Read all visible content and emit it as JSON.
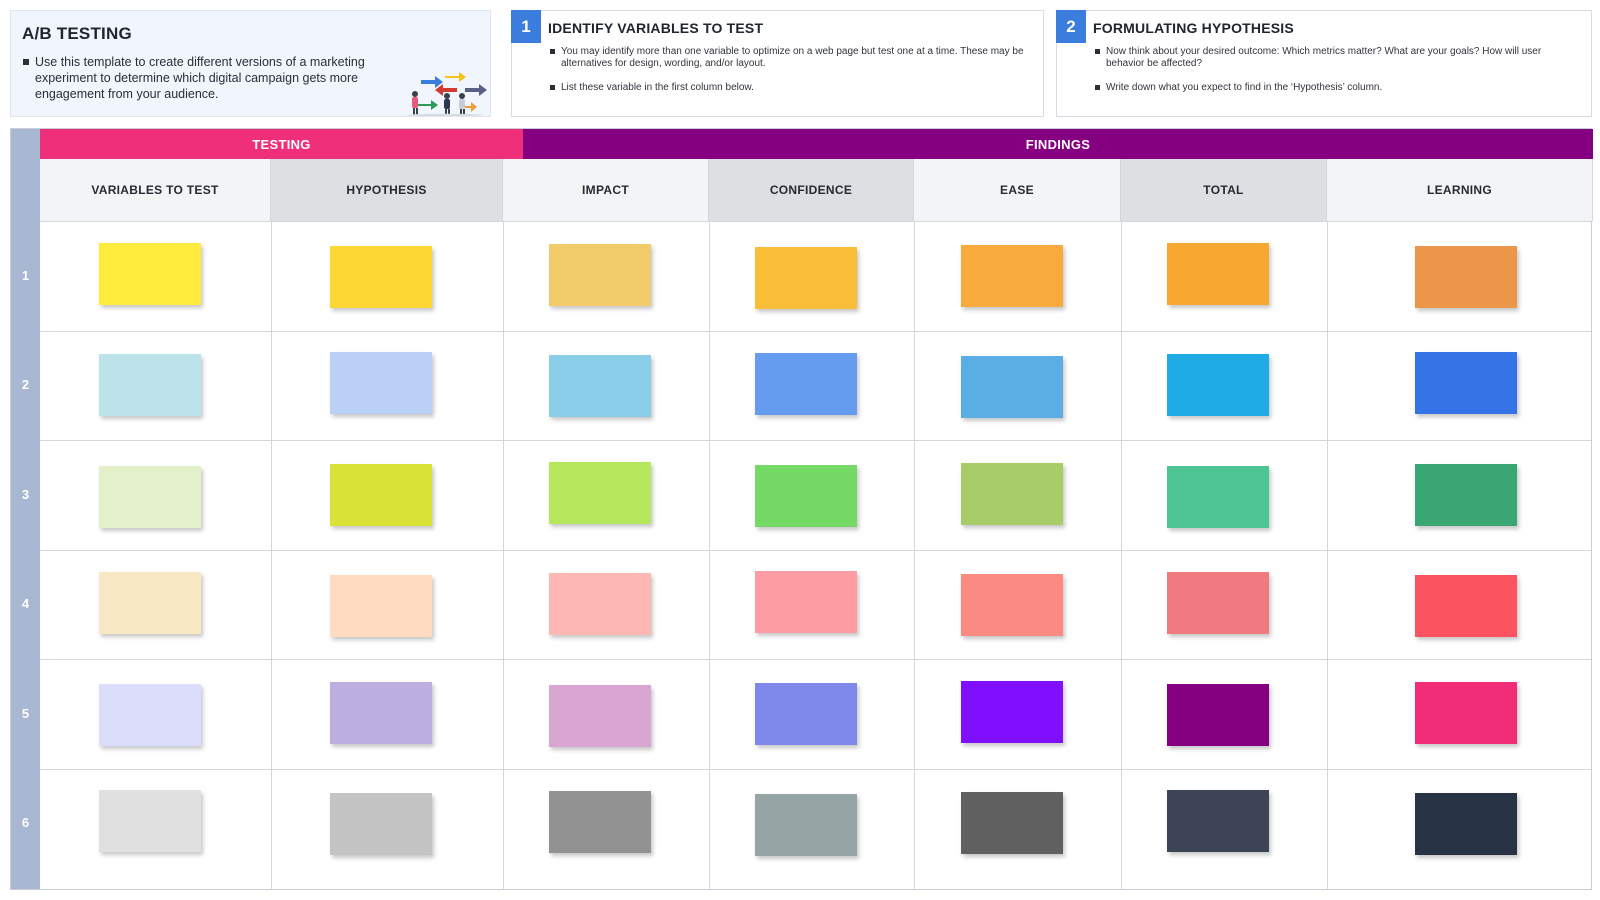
{
  "intro": {
    "title": "A/B TESTING",
    "text": "Use this template to create different versions of a marketing experiment to determine which digital campaign gets more engagement from your audience."
  },
  "steps": [
    {
      "number": "1",
      "title": "IDENTIFY VARIABLES TO TEST",
      "bullets": [
        "You may identify more than one variable to optimize on a web page but test one at a time. These may be alternatives for design, wording, and/or layout.",
        "List these variable in the first column below."
      ]
    },
    {
      "number": "2",
      "title": "FORMULATING HYPOTHESIS",
      "bullets": [
        "Now think about your desired outcome: Which metrics matter? What are your goals? How will user behavior be affected?",
        "Write down what you expect to find in the ‘Hypothesis’ column."
      ]
    }
  ],
  "sections": {
    "testing": "TESTING",
    "findings": "FINDINGS"
  },
  "columns": [
    "VARIABLES TO TEST",
    "HYPOTHESIS",
    "IMPACT",
    "CONFIDENCE",
    "EASE",
    "TOTAL",
    "LEARNING"
  ],
  "rows": [
    "1",
    "2",
    "3",
    "4",
    "5",
    "6"
  ],
  "sticky_colors": [
    [
      "#ffeb3b",
      "#fdd835",
      "#f2cb6b",
      "#f9bd38",
      "#f8ab3c",
      "#f6a730",
      "#ec964a"
    ],
    [
      "#bde3ea",
      "#bccff7",
      "#89cde9",
      "#669cf0",
      "#5aaee3",
      "#1fabe3",
      "#3573e6"
    ],
    [
      "#e3f0ca",
      "#d9e237",
      "#b6e85d",
      "#74d965",
      "#a8cd68",
      "#4cc493",
      "#3aa673"
    ],
    [
      "#f8e8c3",
      "#ffdbc1",
      "#fdb8b3",
      "#fd9ca3",
      "#fb8b82",
      "#ef7b80",
      "#fc5361"
    ],
    [
      "#dcddfa",
      "#bdb0e0",
      "#d9a5d3",
      "#7f89ec",
      "#7f0ffd",
      "#850080",
      "#f12d78"
    ],
    [
      "#e0e0e0",
      "#c4c4c4",
      "#929292",
      "#95a5a6",
      "#606060",
      "#3c4455",
      "#293346"
    ]
  ]
}
